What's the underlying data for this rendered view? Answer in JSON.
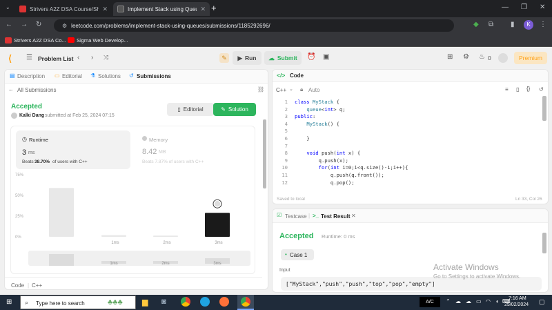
{
  "browser": {
    "tabs": [
      {
        "title": "Strivers A2Z DSA Course/Sheet",
        "active": false
      },
      {
        "title": "Implement Stack using Queues",
        "active": true
      }
    ],
    "url": "leetcode.com/problems/implement-stack-using-queues/submissions/1185292696/",
    "bookmarks": [
      "Strivers A2Z DSA Co...",
      "Sigma Web Develop..."
    ],
    "profile_initial": "K"
  },
  "nav": {
    "problem_list": "Problem List",
    "run": "Run",
    "submit": "Submit",
    "streak": "0",
    "premium": "Premium"
  },
  "left": {
    "tabs": [
      "Description",
      "Editorial",
      "Solutions",
      "Submissions"
    ],
    "all_submissions": "All Submissions",
    "status": "Accepted",
    "user": "Kalki Dang",
    "submitted": "submitted at Feb 25, 2024 07:15",
    "editorial_btn": "Editorial",
    "solution_btn": "Solution",
    "runtime": {
      "label": "Runtime",
      "value": "3",
      "unit": "ms",
      "beats_pre": "Beats",
      "beats_pct": "38.70%",
      "beats_post": "of users with C++"
    },
    "memory": {
      "label": "Memory",
      "value": "8.42",
      "unit": "MB",
      "beats": "Beats 7.87% of users with C++"
    },
    "footer": [
      "Code",
      "C++"
    ]
  },
  "chart_data": {
    "type": "bar",
    "ytick_labels": [
      "75%",
      "50%",
      "25%",
      "0%"
    ],
    "xtick_labels": [
      "1ms",
      "2ms",
      "3ms"
    ],
    "ylim": [
      0,
      75
    ],
    "bars": [
      {
        "value": 59,
        "highlight": false
      },
      {
        "value": 2,
        "highlight": false
      },
      {
        "value": 1.5,
        "highlight": false
      },
      {
        "value": 29,
        "highlight": true
      }
    ],
    "mini_xtick_labels": [
      "1ms",
      "2ms",
      "3ms"
    ]
  },
  "code": {
    "header": "Code",
    "language": "C++",
    "auto": "Auto",
    "lines": [
      {
        "n": "1",
        "t": "class MyStack {"
      },
      {
        "n": "2",
        "t": "    queue<int> q;"
      },
      {
        "n": "3",
        "t": "public:"
      },
      {
        "n": "4",
        "t": "    MyStack() {"
      },
      {
        "n": "5",
        "t": ""
      },
      {
        "n": "6",
        "t": "    }"
      },
      {
        "n": "7",
        "t": ""
      },
      {
        "n": "8",
        "t": "    void push(int x) {"
      },
      {
        "n": "9",
        "t": "        q.push(x);"
      },
      {
        "n": "10",
        "t": "        for(int i=0;i<q.size()-1;i++){"
      },
      {
        "n": "11",
        "t": "            q.push(q.front());"
      },
      {
        "n": "12",
        "t": "            q.pop();"
      }
    ],
    "saved": "Saved to local",
    "cursor": "Ln 33, Col 26"
  },
  "result": {
    "testcase_tab": "Testcase",
    "result_tab": "Test Result",
    "status": "Accepted",
    "runtime": "Runtime: 0 ms",
    "case": "Case 1",
    "input_label": "Input",
    "input": "[\"MyStack\",\"push\",\"push\",\"top\",\"pop\",\"empty\"]"
  },
  "watermark": {
    "title": "Activate Windows",
    "sub": "Go to Settings to activate Windows."
  },
  "taskbar": {
    "search": "Type here to search",
    "ac": "A/C",
    "time": "7:16 AM",
    "date": "25/02/2024"
  }
}
